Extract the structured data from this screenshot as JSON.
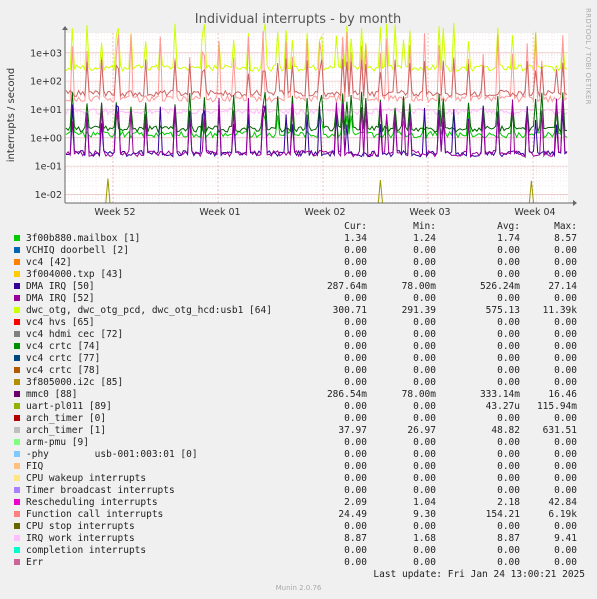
{
  "chart_data": {
    "type": "line",
    "title": "Individual interrupts - by month",
    "ylabel": "interrupts / second",
    "yscale": "log",
    "ylim": [
      0.005,
      5000
    ],
    "ytick_labels": [
      "1e-02",
      "1e-01",
      "1e+00",
      "1e+01",
      "1e+02",
      "1e+03"
    ],
    "xtick_labels": [
      "Week 52",
      "Week 01",
      "Week 02",
      "Week 03",
      "Week 04"
    ],
    "side_label": "RRDTOOL / TOBI OETIKER",
    "series": [
      {
        "name": "dwc_otg, dwc_otg_pcd, dwc_otg_hcd:usb1 [64]",
        "color": "#ccff00",
        "baseline": 300.71,
        "peak": 11390
      },
      {
        "name": "Function call interrupts",
        "color": "#ff9999",
        "baseline": 24.49,
        "peak": 6190
      },
      {
        "name": "arch_timer [1]",
        "color": "#cc6666",
        "baseline": 37.97,
        "peak": 631.51
      },
      {
        "name": "IRQ work interrupts",
        "color": "#ffbbff",
        "baseline": 8.87,
        "peak": 9.41
      },
      {
        "name": "3f00b880.mailbox [1]",
        "color": "#00cc00",
        "baseline": 1.34,
        "peak": 8.57
      },
      {
        "name": "Rescheduling interrupts",
        "color": "#006600",
        "baseline": 2.09,
        "peak": 42.84
      },
      {
        "name": "mmc0 [88]",
        "color": "#330099",
        "baseline": 0.2865,
        "peak": 16.46
      },
      {
        "name": "DMA IRQ [50]",
        "color": "#990099",
        "baseline": 0.2877,
        "peak": 27.14
      },
      {
        "name": "uart-pl011 [89]",
        "color": "#999900",
        "baseline": 0,
        "peak": 0.11594
      }
    ]
  },
  "legend": {
    "headers": [
      "Cur:",
      "Min:",
      "Avg:",
      "Max:"
    ],
    "rows": [
      {
        "name": "3f00b880.mailbox [1]",
        "color": "#00cc00",
        "cur": "1.34",
        "min": "1.24",
        "avg": "1.74",
        "max": "8.57"
      },
      {
        "name": "VCHIQ doorbell [2]",
        "color": "#0066b3",
        "cur": "0.00",
        "min": "0.00",
        "avg": "0.00",
        "max": "0.00"
      },
      {
        "name": "vc4 [42]",
        "color": "#ff8000",
        "cur": "0.00",
        "min": "0.00",
        "avg": "0.00",
        "max": "0.00"
      },
      {
        "name": "3f004000.txp [43]",
        "color": "#ffcc00",
        "cur": "0.00",
        "min": "0.00",
        "avg": "0.00",
        "max": "0.00"
      },
      {
        "name": "DMA IRQ [50]",
        "color": "#330099",
        "cur": "287.64m",
        "min": "78.00m",
        "avg": "526.24m",
        "max": "27.14"
      },
      {
        "name": "DMA IRQ [52]",
        "color": "#990099",
        "cur": "0.00",
        "min": "0.00",
        "avg": "0.00",
        "max": "0.00"
      },
      {
        "name": "dwc_otg, dwc_otg_pcd, dwc_otg_hcd:usb1 [64]",
        "color": "#ccff00",
        "cur": "300.71",
        "min": "291.39",
        "avg": "575.13",
        "max": "11.39k"
      },
      {
        "name": "vc4 hvs [65]",
        "color": "#ff0000",
        "cur": "0.00",
        "min": "0.00",
        "avg": "0.00",
        "max": "0.00"
      },
      {
        "name": "vc4 hdmi cec [72]",
        "color": "#808080",
        "cur": "0.00",
        "min": "0.00",
        "avg": "0.00",
        "max": "0.00"
      },
      {
        "name": "vc4 crtc [74]",
        "color": "#008f00",
        "cur": "0.00",
        "min": "0.00",
        "avg": "0.00",
        "max": "0.00"
      },
      {
        "name": "vc4 crtc [77]",
        "color": "#00487d",
        "cur": "0.00",
        "min": "0.00",
        "avg": "0.00",
        "max": "0.00"
      },
      {
        "name": "vc4 crtc [78]",
        "color": "#b35a00",
        "cur": "0.00",
        "min": "0.00",
        "avg": "0.00",
        "max": "0.00"
      },
      {
        "name": "3f805000.i2c [85]",
        "color": "#b38f00",
        "cur": "0.00",
        "min": "0.00",
        "avg": "0.00",
        "max": "0.00"
      },
      {
        "name": "mmc0 [88]",
        "color": "#6b006b",
        "cur": "286.54m",
        "min": "78.00m",
        "avg": "333.14m",
        "max": "16.46"
      },
      {
        "name": "uart-pl011 [89]",
        "color": "#8fb300",
        "cur": "0.00",
        "min": "0.00",
        "avg": "43.27u",
        "max": "115.94m"
      },
      {
        "name": "arch_timer [0]",
        "color": "#b30000",
        "cur": "0.00",
        "min": "0.00",
        "avg": "0.00",
        "max": "0.00"
      },
      {
        "name": "arch_timer [1]",
        "color": "#bebebe",
        "cur": "37.97",
        "min": "26.97",
        "avg": "48.82",
        "max": "631.51"
      },
      {
        "name": "arm-pmu [9]",
        "color": "#80ff80",
        "cur": "0.00",
        "min": "0.00",
        "avg": "0.00",
        "max": "0.00"
      },
      {
        "name": "-phy        usb-001:003:01 [0]",
        "color": "#80c9ff",
        "cur": "0.00",
        "min": "0.00",
        "avg": "0.00",
        "max": "0.00"
      },
      {
        "name": "FIQ",
        "color": "#ffc080",
        "cur": "0.00",
        "min": "0.00",
        "avg": "0.00",
        "max": "0.00"
      },
      {
        "name": "CPU wakeup interrupts",
        "color": "#ffe680",
        "cur": "0.00",
        "min": "0.00",
        "avg": "0.00",
        "max": "0.00"
      },
      {
        "name": "Timer broadcast interrupts",
        "color": "#aa80ff",
        "cur": "0.00",
        "min": "0.00",
        "avg": "0.00",
        "max": "0.00"
      },
      {
        "name": "Rescheduling interrupts",
        "color": "#ee00cc",
        "cur": "2.09",
        "min": "1.04",
        "avg": "2.18",
        "max": "42.84"
      },
      {
        "name": "Function call interrupts",
        "color": "#ff8080",
        "cur": "24.49",
        "min": "9.30",
        "avg": "154.21",
        "max": "6.19k"
      },
      {
        "name": "CPU stop interrupts",
        "color": "#666600",
        "cur": "0.00",
        "min": "0.00",
        "avg": "0.00",
        "max": "0.00"
      },
      {
        "name": "IRQ work interrupts",
        "color": "#ffbfff",
        "cur": "8.87",
        "min": "1.68",
        "avg": "8.87",
        "max": "9.41"
      },
      {
        "name": "completion interrupts",
        "color": "#00ffcc",
        "cur": "0.00",
        "min": "0.00",
        "avg": "0.00",
        "max": "0.00"
      },
      {
        "name": "Err",
        "color": "#cc6699",
        "cur": "0.00",
        "min": "0.00",
        "avg": "0.00",
        "max": "0.00"
      }
    ]
  },
  "footer": {
    "last_update": "Last update: Fri Jan 24 13:00:21 2025",
    "munin": "Munin 2.0.76"
  }
}
